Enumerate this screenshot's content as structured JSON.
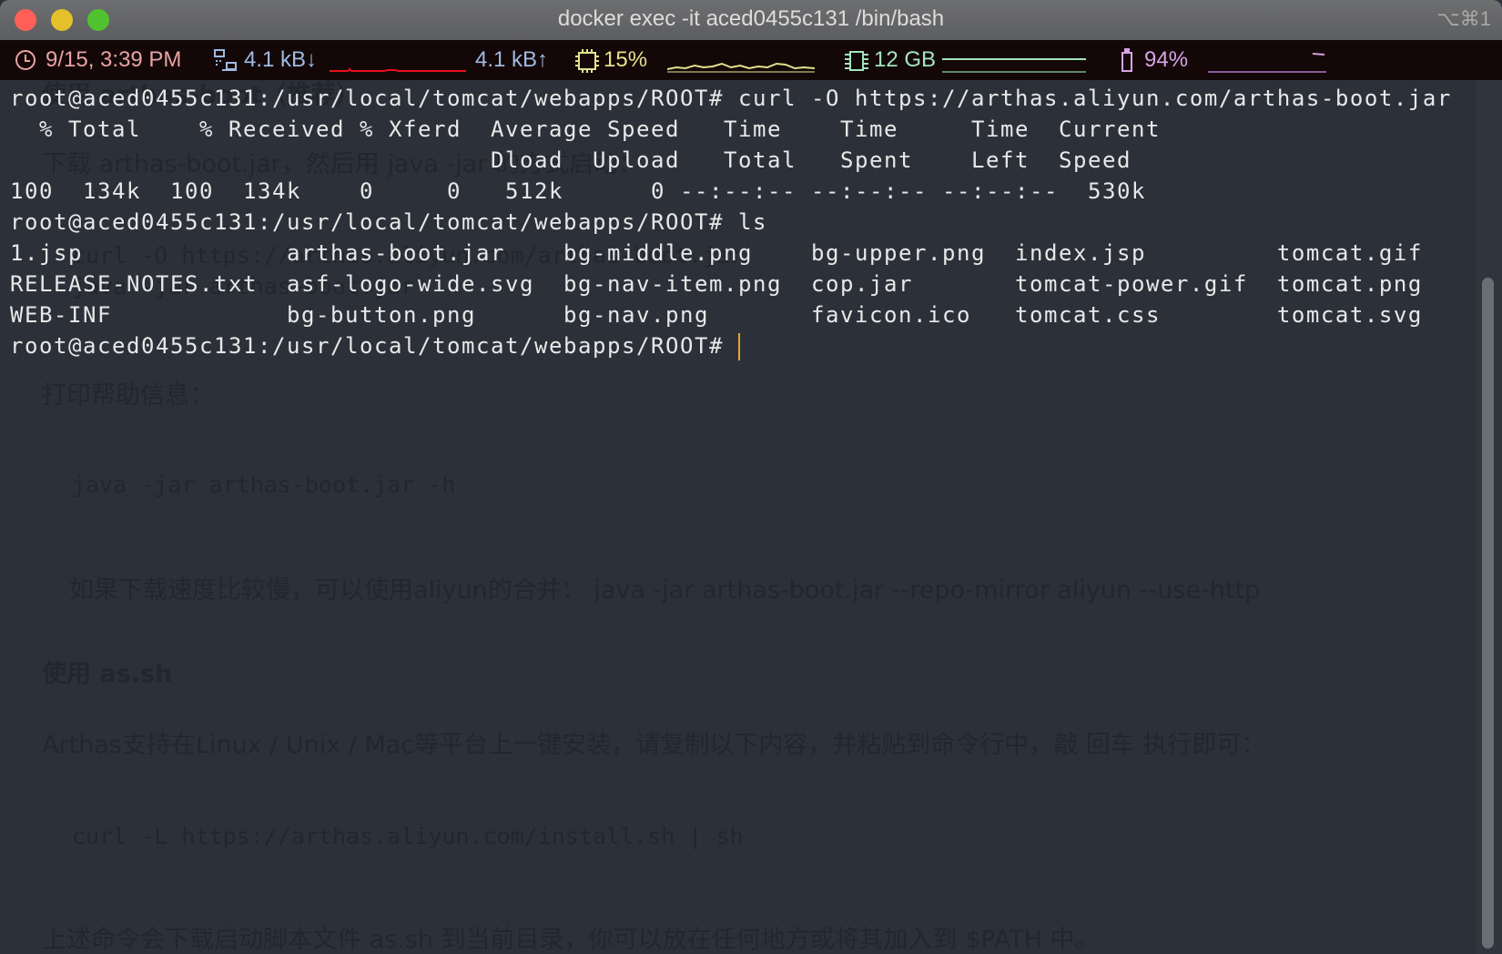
{
  "window": {
    "title": "docker exec -it aced0455c131 /bin/bash",
    "shortcut": "⌥⌘1",
    "traffic_lights": {
      "close": "#fe5f57",
      "minimize": "#e6c02b",
      "maximize": "#50c22f"
    }
  },
  "status_bar": {
    "clock": {
      "icon": "clock-icon",
      "text": "9/15, 3:39 PM",
      "color": "#e9a3a3"
    },
    "network": {
      "icon": "network-icon",
      "down": "4.1 kB↓",
      "up": "4.1 kB↑",
      "color": "#9fbbe3",
      "graph_color": "#e8101c"
    },
    "cpu": {
      "icon": "cpu-chip-icon",
      "text": "15%",
      "color": "#e2e28e"
    },
    "memory": {
      "icon": "memory-icon",
      "text": "12 GB",
      "color": "#a3e4bd"
    },
    "battery": {
      "icon": "battery-icon",
      "text": "94%",
      "color": "#d9a3e6"
    }
  },
  "terminal": {
    "lines": [
      "root@aced0455c131:/usr/local/tomcat/webapps/ROOT# curl -O https://arthas.aliyun.com/arthas-boot.jar",
      "  % Total    % Received % Xferd  Average Speed   Time    Time     Time  Current",
      "                                 Dload  Upload   Total   Spent    Left  Speed",
      "100  134k  100  134k    0     0   512k      0 --:--:-- --:--:-- --:--:--  530k",
      "root@aced0455c131:/usr/local/tomcat/webapps/ROOT# ls",
      "1.jsp              arthas-boot.jar    bg-middle.png    bg-upper.png  index.jsp         tomcat.gif",
      "RELEASE-NOTES.txt  asf-logo-wide.svg  bg-nav-item.png  cop.jar       tomcat-power.gif  tomcat.png",
      "WEB-INF            bg-button.png      bg-nav.png       favicon.ico   tomcat.css        tomcat.svg"
    ],
    "prompt": "root@aced0455c131:/usr/local/tomcat/webapps/ROOT# ",
    "cursor_color": "#e8a33a"
  },
  "background_page": {
    "heading1": "使用 arthas-boot（推荐）",
    "p1": "下载 arthas-boot.jar，然后用 java -jar 的方式启动：",
    "code1a": "curl -O https://arthas.aliyun.com/arthas-boot.jar",
    "code1b": "java -jar arthas-boot.jar",
    "p2": "打印帮助信息：",
    "code2": "java -jar arthas-boot.jar -h",
    "bullet": "如果下载速度比较慢，可以使用aliyun的合并： java -jar arthas-boot.jar --repo-mirror aliyun --use-http",
    "heading2": "使用 as.sh",
    "p3": "Arthas支持在Linux / Unix / Mac等平台上一键安装，请复制以下内容，并粘贴到命令行中，敲 回车 执行即可：",
    "code3": "curl -L https://arthas.aliyun.com/install.sh | sh",
    "p4": "上述命令会下载启动脚本文件 as.sh 到当前目录，你可以放在任何地方或将其加入到 $PATH 中。"
  }
}
